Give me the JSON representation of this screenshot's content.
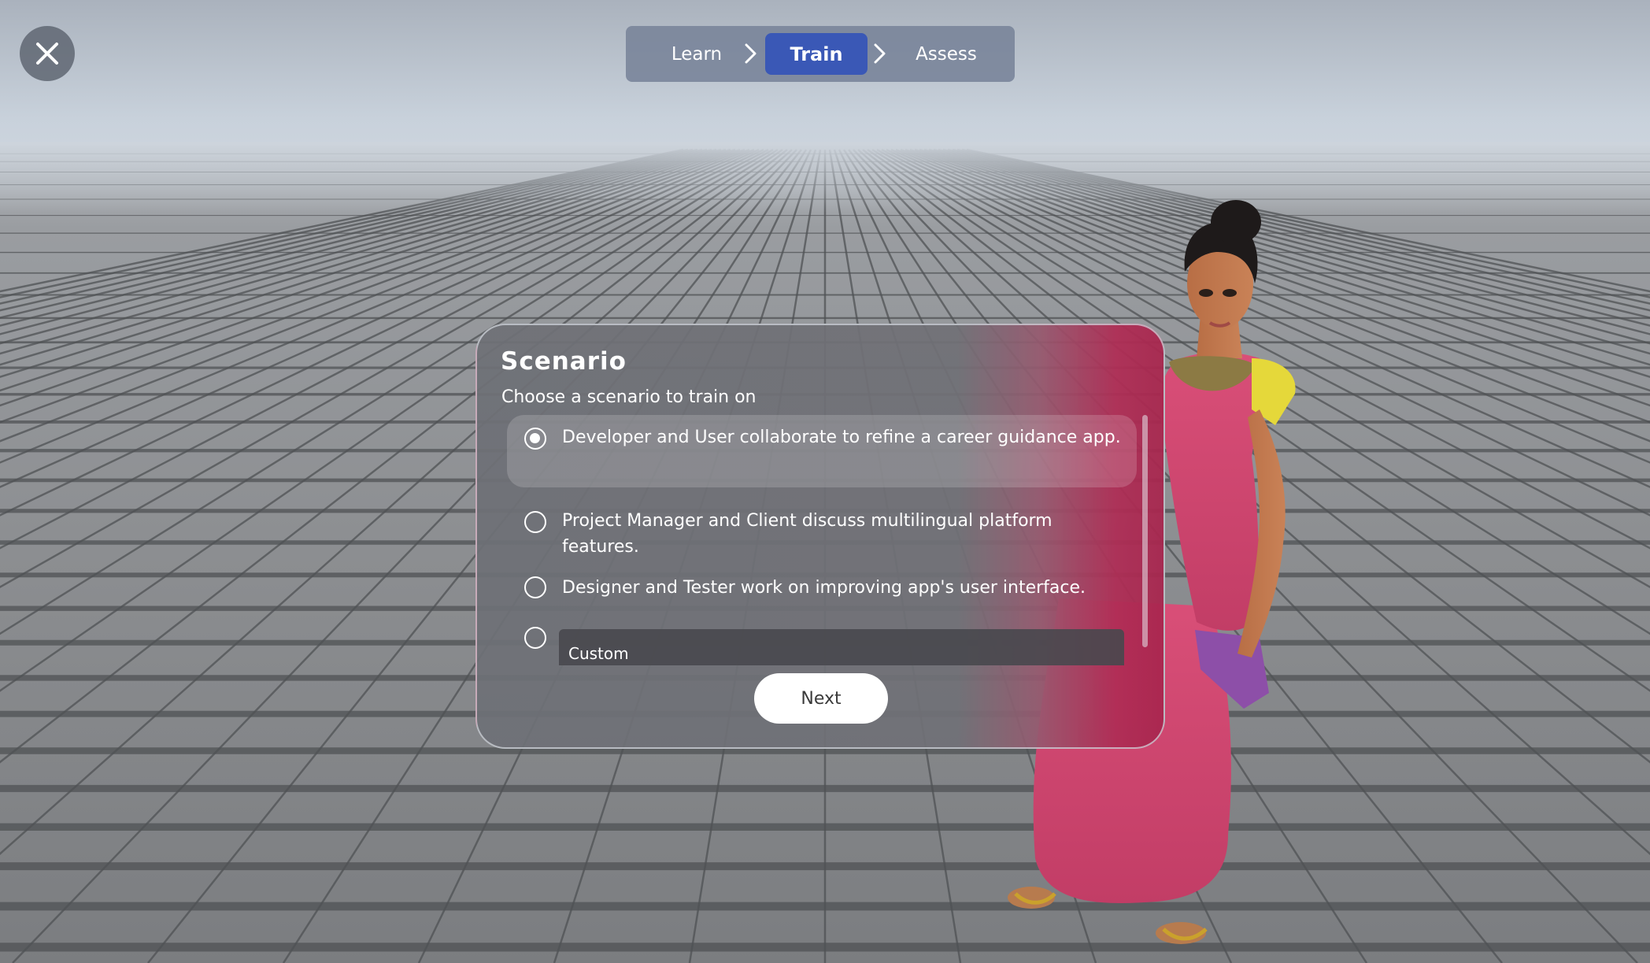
{
  "window": {
    "close_icon": "close-icon"
  },
  "stepper": {
    "steps": [
      {
        "label": "Learn",
        "active": false
      },
      {
        "label": "Train",
        "active": true
      },
      {
        "label": "Assess",
        "active": false
      }
    ],
    "separator_icon": "chevron-right-icon",
    "active_color": "#3a58b6"
  },
  "dialog": {
    "title": "Scenario",
    "subtitle": "Choose a scenario to train on",
    "options": [
      {
        "label": "Developer and User collaborate to refine a career guidance app.",
        "selected": true
      },
      {
        "label": "Project Manager and Client discuss multilingual platform features.",
        "selected": false
      },
      {
        "label": "Designer and Tester work on improving app's user interface.",
        "selected": false
      },
      {
        "label": "",
        "selected": false
      }
    ],
    "custom_placeholder": "Custom",
    "next_label": "Next"
  },
  "scene": {
    "avatar": "3d-avatar-woman-pink-dress",
    "floor": "grey-stone-tiles",
    "accent_color": "#b3305f"
  }
}
